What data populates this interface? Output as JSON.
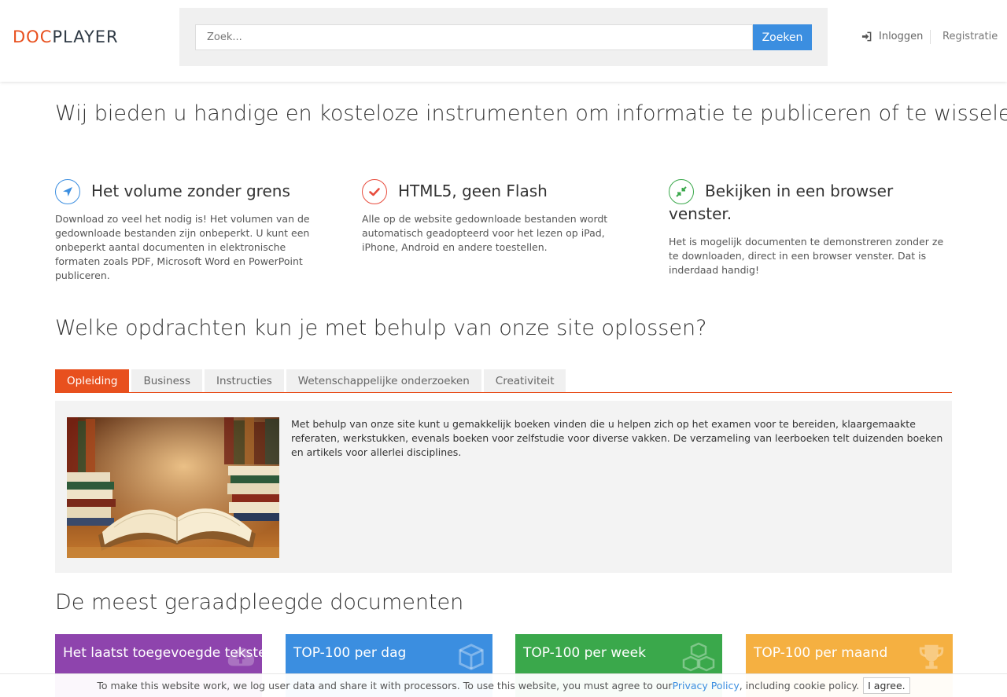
{
  "header": {
    "logo_doc": "DOC",
    "logo_player": "PLAYER",
    "search_placeholder": "Zoek...",
    "search_button": "Zoeken",
    "login": "Inloggen",
    "register": "Registratie"
  },
  "intro": {
    "title": "Wij bieden u handige en kosteloze instrumenten om informatie te publiceren of te wisselen."
  },
  "features": [
    {
      "title": "Het volume zonder grens",
      "icon": "navigation-arrow-icon",
      "color": "#3b8ee0",
      "text": "Download zo veel het nodig is! Het volumen van de gedownloade bestanden zijn onbeperkt. U kunt een onbeperkt aantal documenten in elektronische formaten zoals PDF, Microsoft Word en PowerPoint publiceren."
    },
    {
      "title": "HTML5, geen Flash",
      "icon": "checkmark-icon",
      "color": "#e84c3d",
      "text": "Alle op de website gedownloade bestanden wordt automatisch geadopteerd voor het lezen op iPad, iPhone, Android en andere toestellen."
    },
    {
      "title": "Bekijken in een browser venster.",
      "icon": "compress-arrows-icon",
      "color": "#3aa84b",
      "text": "Het is mogelijk documenten te demonstreren zonder ze te downloaden, direct in een browser venster. Dat is inderdaad handig!"
    }
  ],
  "tasks": {
    "title": "Welke opdrachten kun je met behulp van onze site oplossen?",
    "tabs": [
      "Opleiding",
      "Business",
      "Instructies",
      "Wetenschappelijke onderzoeken",
      "Creativiteit"
    ],
    "active_tab": "Opleiding",
    "panel_text": "Met behulp van onze site kunt u gemakkelijk boeken vinden die u helpen zich op het examen voor te bereiden, klaargemaakte referaten, werkstukken, evenals boeken voor zelfstudie voor diverse vakken. De verzameling van leerboeken telt duizenden boeken en artikels voor allerlei disciplines."
  },
  "documents": {
    "title": "De meest geraadpleegde documenten",
    "cards": [
      {
        "title": "Het laatst toegevoegde teksten",
        "color": "#8e44ad",
        "icon": "cloud-upload-icon"
      },
      {
        "title": "TOP-100 per dag",
        "color": "#3b8ee0",
        "icon": "cube-icon"
      },
      {
        "title": "TOP-100 per week",
        "color": "#3aa84b",
        "icon": "cubes-icon"
      },
      {
        "title": "TOP-100 per maand",
        "color": "#f5b041",
        "icon": "trophy-icon"
      }
    ]
  },
  "cookie": {
    "text_before": "To make this website work, we log user data and share it with processors. To use this website, you must agree to our ",
    "link": "Privacy Policy",
    "text_after": ", including cookie policy.",
    "button": "I agree."
  }
}
